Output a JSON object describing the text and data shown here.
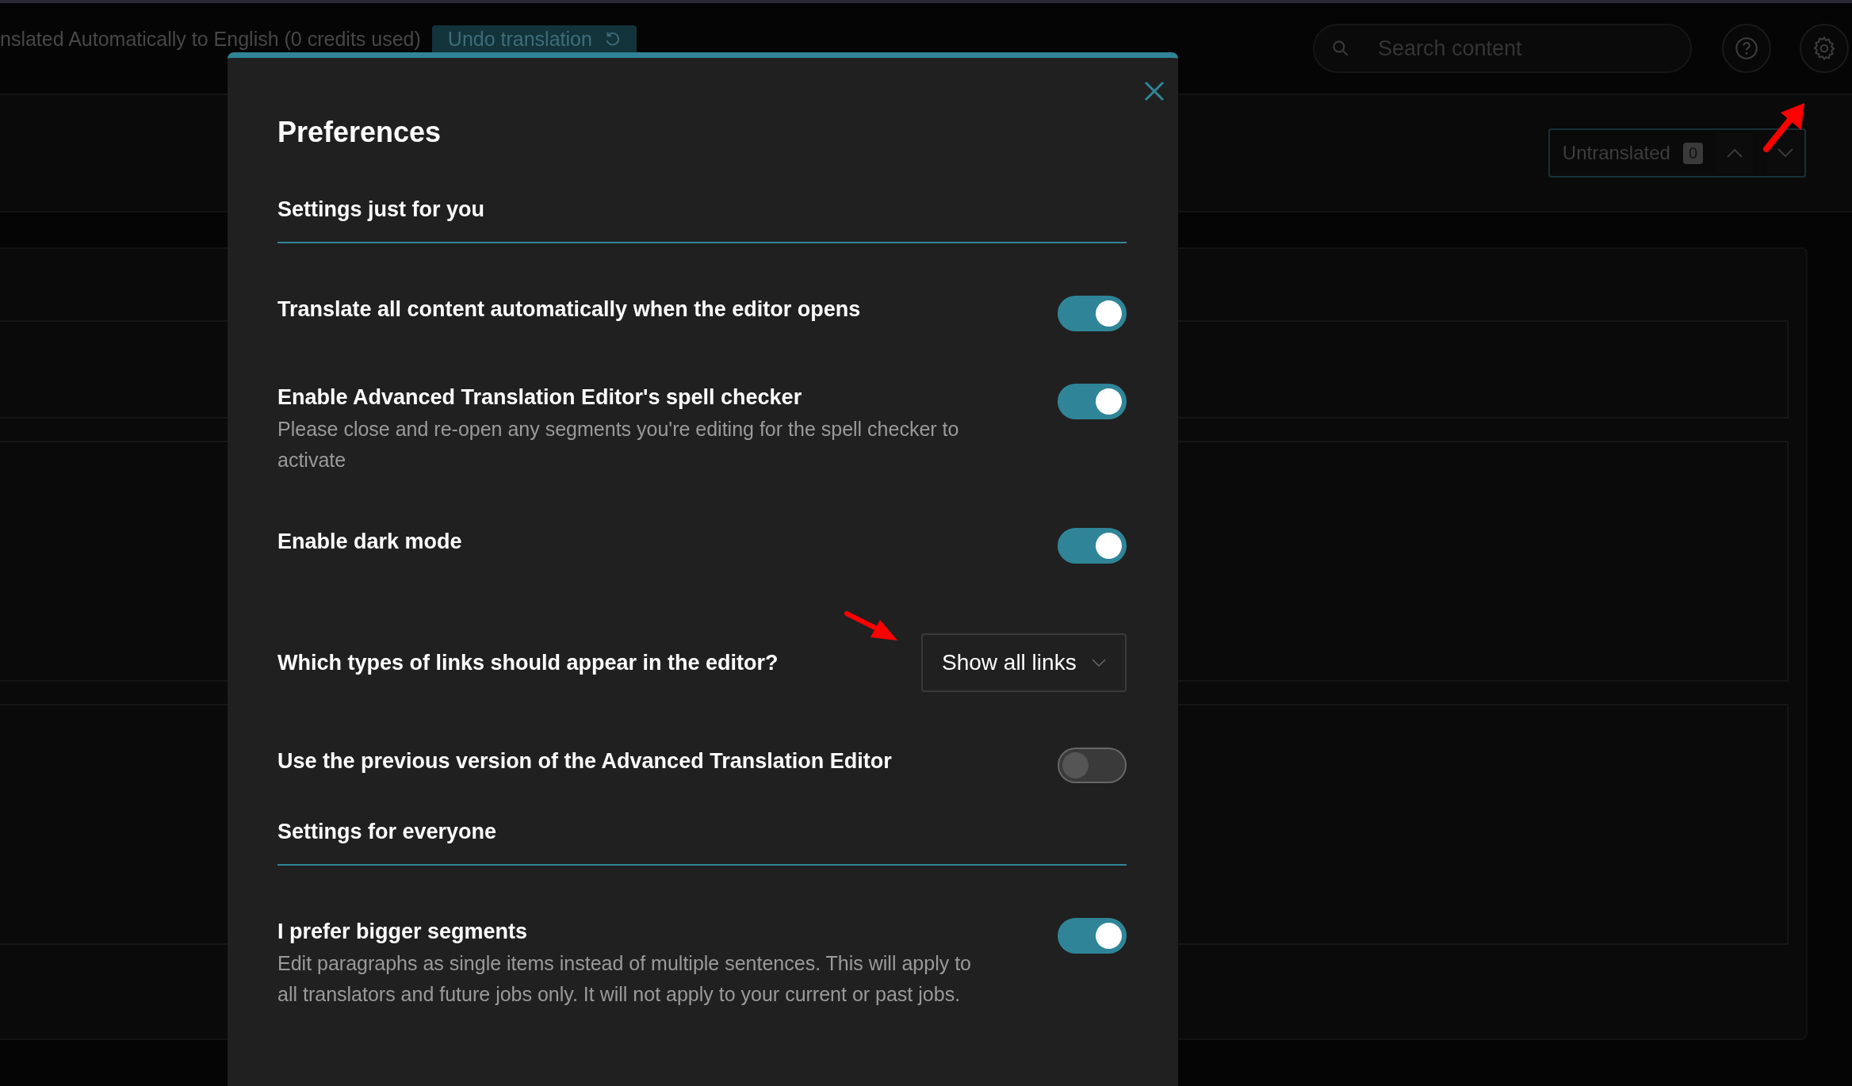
{
  "top_bar": {
    "status_text": "nslated Automatically to English (0 credits used)",
    "undo_button": "Undo translation",
    "search": {
      "placeholder": "Search content"
    }
  },
  "filter": {
    "label": "Untranslated",
    "count": "0"
  },
  "dialog": {
    "title": "Preferences",
    "sections": [
      {
        "heading": "Settings just for you",
        "settings": [
          {
            "kind": "toggle",
            "label": "Translate all content automatically when the editor opens",
            "on": true
          },
          {
            "kind": "toggle",
            "label": "Enable Advanced Translation Editor's spell checker",
            "description": "Please close and re-open any segments you're editing for the spell checker to activate",
            "on": true
          },
          {
            "kind": "toggle",
            "label": "Enable dark mode",
            "on": true
          },
          {
            "kind": "select",
            "label": "Which types of links should appear in the editor?",
            "value": "Show all links"
          },
          {
            "kind": "toggle",
            "label": "Use the previous version of the Advanced Translation Editor",
            "on": false
          }
        ]
      },
      {
        "heading": "Settings for everyone",
        "settings": [
          {
            "kind": "toggle",
            "label": "I prefer bigger segments",
            "description": "Edit paragraphs as single items instead of multiple sentences. This will apply to all translators and future jobs only. It will not apply to your current or past jobs.",
            "on": true
          }
        ]
      }
    ]
  }
}
